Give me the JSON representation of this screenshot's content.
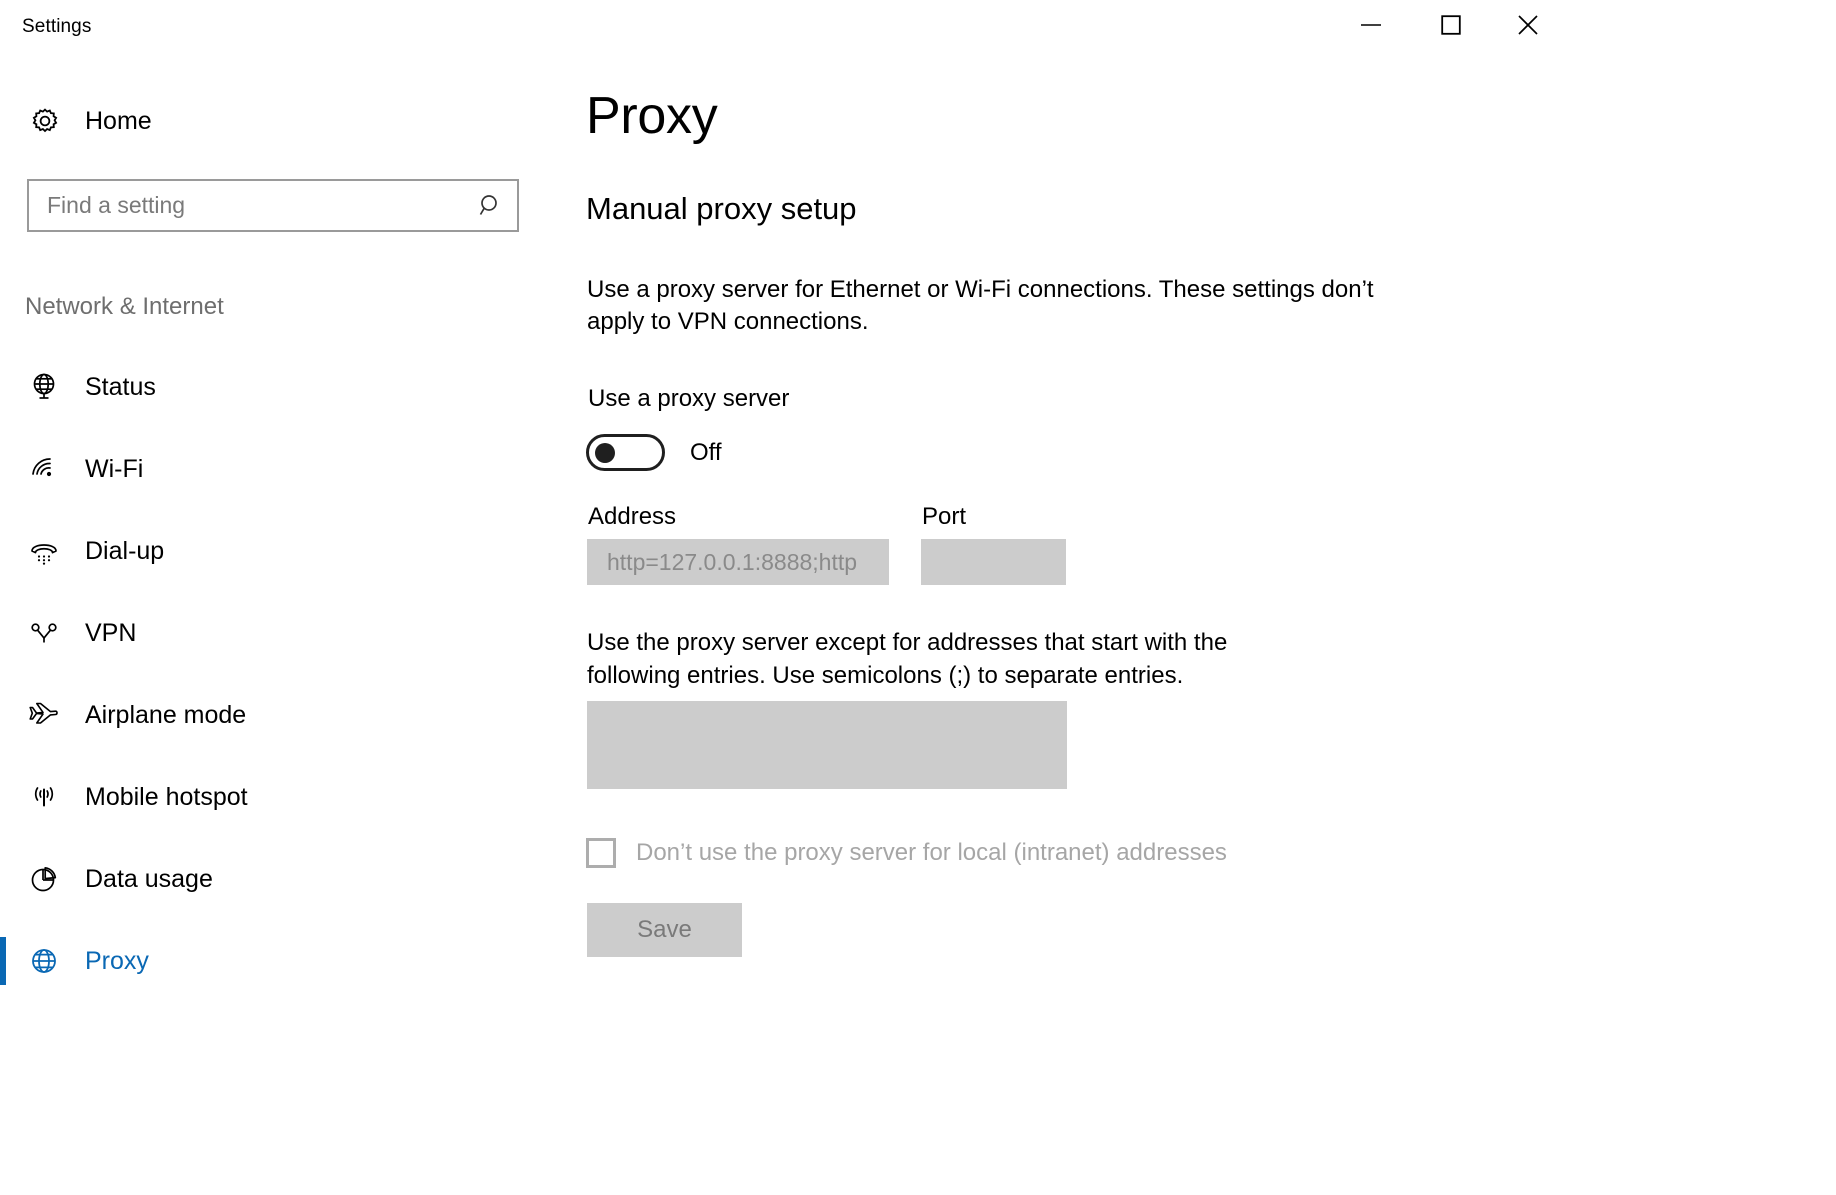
{
  "window": {
    "app_title": "Settings",
    "controls": {
      "minimize": "minimize-icon",
      "maximize": "maximize-icon",
      "close": "close-icon"
    }
  },
  "sidebar": {
    "home": {
      "label": "Home",
      "icon": "gear-icon"
    },
    "search": {
      "placeholder": "Find a setting",
      "value": "",
      "icon": "search-icon"
    },
    "category": "Network & Internet",
    "items": [
      {
        "label": "Status",
        "icon": "globe-monitor-icon",
        "selected": false
      },
      {
        "label": "Wi-Fi",
        "icon": "wifi-icon",
        "selected": false
      },
      {
        "label": "Dial-up",
        "icon": "dialup-phone-icon",
        "selected": false
      },
      {
        "label": "VPN",
        "icon": "vpn-icon",
        "selected": false
      },
      {
        "label": "Airplane mode",
        "icon": "airplane-icon",
        "selected": false
      },
      {
        "label": "Mobile hotspot",
        "icon": "hotspot-icon",
        "selected": false
      },
      {
        "label": "Data usage",
        "icon": "pie-chart-icon",
        "selected": false
      },
      {
        "label": "Proxy",
        "icon": "globe-icon",
        "selected": true
      }
    ]
  },
  "main": {
    "page_title": "Proxy",
    "section_title": "Manual proxy setup",
    "intro_text": "Use a proxy server for Ethernet or Wi-Fi connections. These settings don’t apply to VPN connections.",
    "toggle": {
      "label": "Use a proxy server",
      "state_text": "Off",
      "checked": false
    },
    "address": {
      "label": "Address",
      "value": "",
      "placeholder": "http=127.0.0.1:8888;http"
    },
    "port": {
      "label": "Port",
      "value": "",
      "placeholder": ""
    },
    "exception": {
      "text": "Use the proxy server except for addresses that start with the following entries. Use semicolons (;) to separate entries.",
      "value": "",
      "placeholder": ""
    },
    "local_checkbox": {
      "label": "Don’t use the proxy server for local (intranet) addresses",
      "checked": false
    },
    "save_button": "Save"
  },
  "colors": {
    "accent": "#0a68b4",
    "disabled_field": "#cccccc",
    "disabled_text": "#8a8a8a",
    "muted_text": "#6e6e6e"
  }
}
